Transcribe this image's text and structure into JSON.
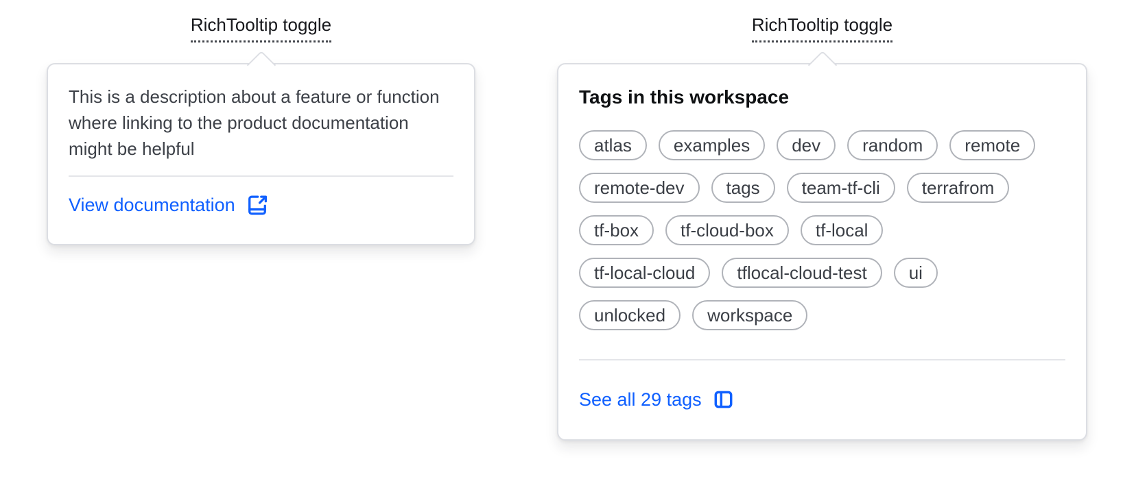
{
  "left_tooltip": {
    "toggle_label": "RichTooltip toggle",
    "description": "This is a description about a feature or function where linking to the product documentation might be helpful",
    "link_label": "View documentation",
    "link_icon": "external-link-icon"
  },
  "right_tooltip": {
    "toggle_label": "RichTooltip toggle",
    "heading": "Tags in this workspace",
    "tag_rows": [
      [
        "atlas",
        "examples",
        "dev",
        "random",
        "remote"
      ],
      [
        "remote-dev",
        "tags",
        "team-tf-cli",
        "terrafrom"
      ],
      [
        "tf-box",
        "tf-cloud-box",
        "tf-local"
      ],
      [
        "tf-local-cloud",
        "tflocal-cloud-test",
        "ui"
      ],
      [
        "unlocked",
        "workspace"
      ]
    ],
    "tag_count_visible": 17,
    "see_all_label": "See all 29 tags",
    "link_icon": "sidebar-panel-icon"
  },
  "colors": {
    "link_blue": "#1060ff",
    "text_primary": "#3d4148",
    "text_strong": "#0f1113",
    "tag_text": "#3b3f46",
    "tag_border": "#b0b3b9",
    "card_border": "#dcdee3",
    "divider": "#e4e5e9",
    "background": "#ffffff"
  }
}
